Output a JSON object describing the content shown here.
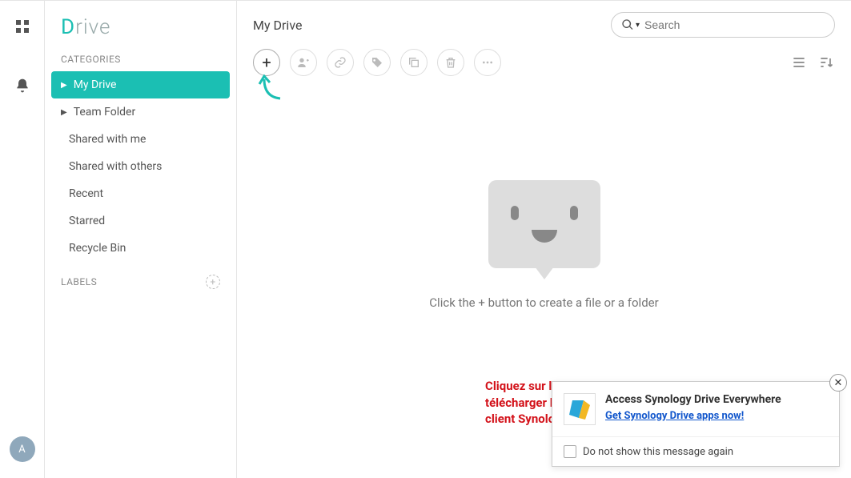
{
  "logo": {
    "letter": "D",
    "rest": "rive"
  },
  "sidebar": {
    "categories_label": "CATEGORIES",
    "labels_label": "LABELS",
    "items": [
      {
        "label": "My Drive"
      },
      {
        "label": "Team Folder"
      },
      {
        "label": "Shared with me"
      },
      {
        "label": "Shared with others"
      },
      {
        "label": "Recent"
      },
      {
        "label": "Starred"
      },
      {
        "label": "Recycle Bin"
      }
    ]
  },
  "page": {
    "title": "My Drive"
  },
  "search": {
    "placeholder": "Search"
  },
  "empty": {
    "message": "Click the + button to create a file or a folder"
  },
  "popup": {
    "title": "Access Synology Drive Everywhere",
    "link": "Get Synology Drive apps now!",
    "footer_label": "Do not show this message again"
  },
  "annotation": {
    "line1": "Cliquez sur le lien pour",
    "line2": "télécharger le logiciel",
    "line3": "client Synology Drive"
  },
  "avatar": {
    "initial": "A"
  },
  "icons": {
    "plus": "+",
    "add_label": "+",
    "close": "✕"
  }
}
